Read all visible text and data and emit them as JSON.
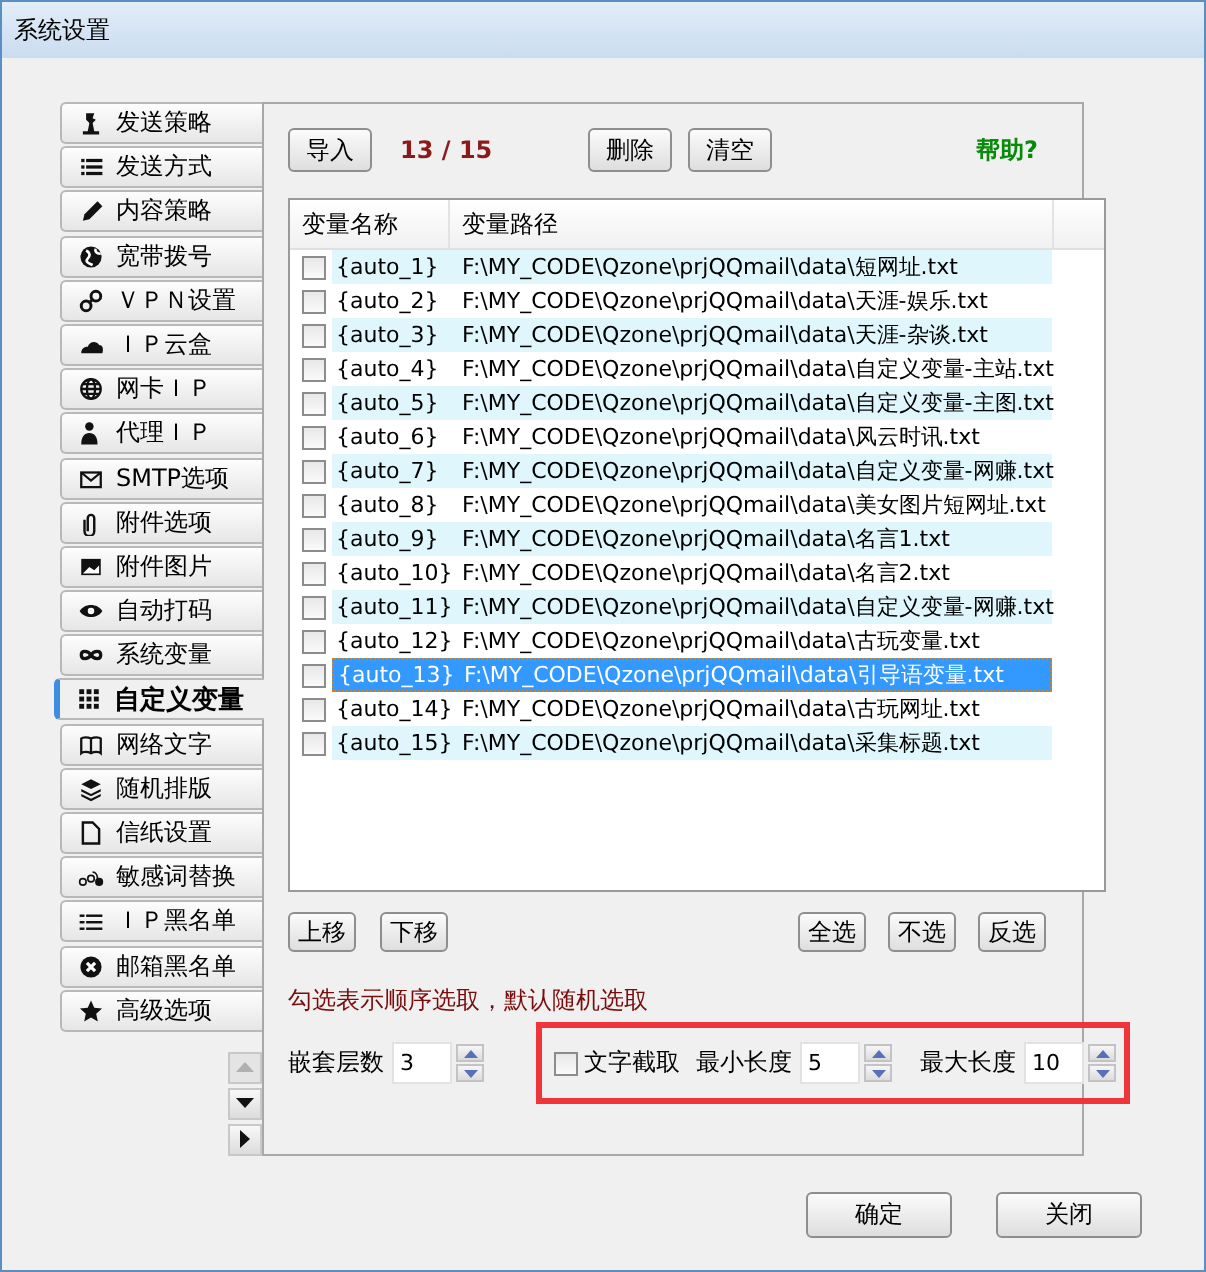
{
  "window": {
    "title": "系统设置"
  },
  "sidebar": {
    "items": [
      {
        "label": "发送策略",
        "selected": false
      },
      {
        "label": "发送方式",
        "selected": false
      },
      {
        "label": "内容策略",
        "selected": false
      },
      {
        "label": "宽带拨号",
        "selected": false
      },
      {
        "label": "ＶＰＮ设置",
        "selected": false
      },
      {
        "label": "ＩＰ云盒",
        "selected": false
      },
      {
        "label": "网卡ＩＰ",
        "selected": false
      },
      {
        "label": "代理ＩＰ",
        "selected": false
      },
      {
        "label": "SMTP选项",
        "selected": false
      },
      {
        "label": "附件选项",
        "selected": false
      },
      {
        "label": "附件图片",
        "selected": false
      },
      {
        "label": "自动打码",
        "selected": false
      },
      {
        "label": "系统变量",
        "selected": false
      },
      {
        "label": "自定义变量",
        "selected": true
      },
      {
        "label": "网络文字",
        "selected": false
      },
      {
        "label": "随机排版",
        "selected": false
      },
      {
        "label": "信纸设置",
        "selected": false
      },
      {
        "label": "敏感词替换",
        "selected": false
      },
      {
        "label": "ＩＰ黑名单",
        "selected": false
      },
      {
        "label": "邮箱黑名单",
        "selected": false
      },
      {
        "label": "高级选项",
        "selected": false
      }
    ]
  },
  "toolbar": {
    "import_button": "导入",
    "counter": "13 / 15",
    "delete_button": "删除",
    "clear_button": "清空",
    "help_link": "帮助?"
  },
  "table": {
    "columns": [
      "变量名称",
      "变量路径"
    ],
    "rows": [
      {
        "name": "{auto_1}",
        "path": "F:\\MY_CODE\\Qzone\\prjQQmail\\data\\短网址.txt",
        "checked": false,
        "selected": false
      },
      {
        "name": "{auto_2}",
        "path": "F:\\MY_CODE\\Qzone\\prjQQmail\\data\\天涯-娱乐.txt",
        "checked": false,
        "selected": false
      },
      {
        "name": "{auto_3}",
        "path": "F:\\MY_CODE\\Qzone\\prjQQmail\\data\\天涯-杂谈.txt",
        "checked": false,
        "selected": false
      },
      {
        "name": "{auto_4}",
        "path": "F:\\MY_CODE\\Qzone\\prjQQmail\\data\\自定义变量-主站.txt",
        "checked": false,
        "selected": false
      },
      {
        "name": "{auto_5}",
        "path": "F:\\MY_CODE\\Qzone\\prjQQmail\\data\\自定义变量-主图.txt",
        "checked": false,
        "selected": false
      },
      {
        "name": "{auto_6}",
        "path": "F:\\MY_CODE\\Qzone\\prjQQmail\\data\\风云时讯.txt",
        "checked": false,
        "selected": false
      },
      {
        "name": "{auto_7}",
        "path": "F:\\MY_CODE\\Qzone\\prjQQmail\\data\\自定义变量-网赚.txt",
        "checked": false,
        "selected": false
      },
      {
        "name": "{auto_8}",
        "path": "F:\\MY_CODE\\Qzone\\prjQQmail\\data\\美女图片短网址.txt",
        "checked": false,
        "selected": false
      },
      {
        "name": "{auto_9}",
        "path": "F:\\MY_CODE\\Qzone\\prjQQmail\\data\\名言1.txt",
        "checked": false,
        "selected": false
      },
      {
        "name": "{auto_10}",
        "path": "F:\\MY_CODE\\Qzone\\prjQQmail\\data\\名言2.txt",
        "checked": false,
        "selected": false
      },
      {
        "name": "{auto_11}",
        "path": "F:\\MY_CODE\\Qzone\\prjQQmail\\data\\自定义变量-网赚.txt",
        "checked": false,
        "selected": false
      },
      {
        "name": "{auto_12}",
        "path": "F:\\MY_CODE\\Qzone\\prjQQmail\\data\\古玩变量.txt",
        "checked": false,
        "selected": false
      },
      {
        "name": "{auto_13}",
        "path": "F:\\MY_CODE\\Qzone\\prjQQmail\\data\\引导语变量.txt",
        "checked": false,
        "selected": true
      },
      {
        "name": "{auto_14}",
        "path": "F:\\MY_CODE\\Qzone\\prjQQmail\\data\\古玩网址.txt",
        "checked": false,
        "selected": false
      },
      {
        "name": "{auto_15}",
        "path": "F:\\MY_CODE\\Qzone\\prjQQmail\\data\\采集标题.txt",
        "checked": false,
        "selected": false
      }
    ]
  },
  "list_buttons": {
    "left": [
      "上移",
      "下移"
    ],
    "right": [
      "全选",
      "不选",
      "反选"
    ]
  },
  "hint": "勾选表示顺序选取，默认随机选取",
  "nesting": {
    "label": "嵌套层数",
    "value": "3"
  },
  "truncate": {
    "label": "文字截取",
    "checked": false,
    "min_label": "最小长度",
    "min_value": "5",
    "max_label": "最大长度",
    "max_value": "10"
  },
  "buttons": [
    "确定",
    "关闭"
  ]
}
